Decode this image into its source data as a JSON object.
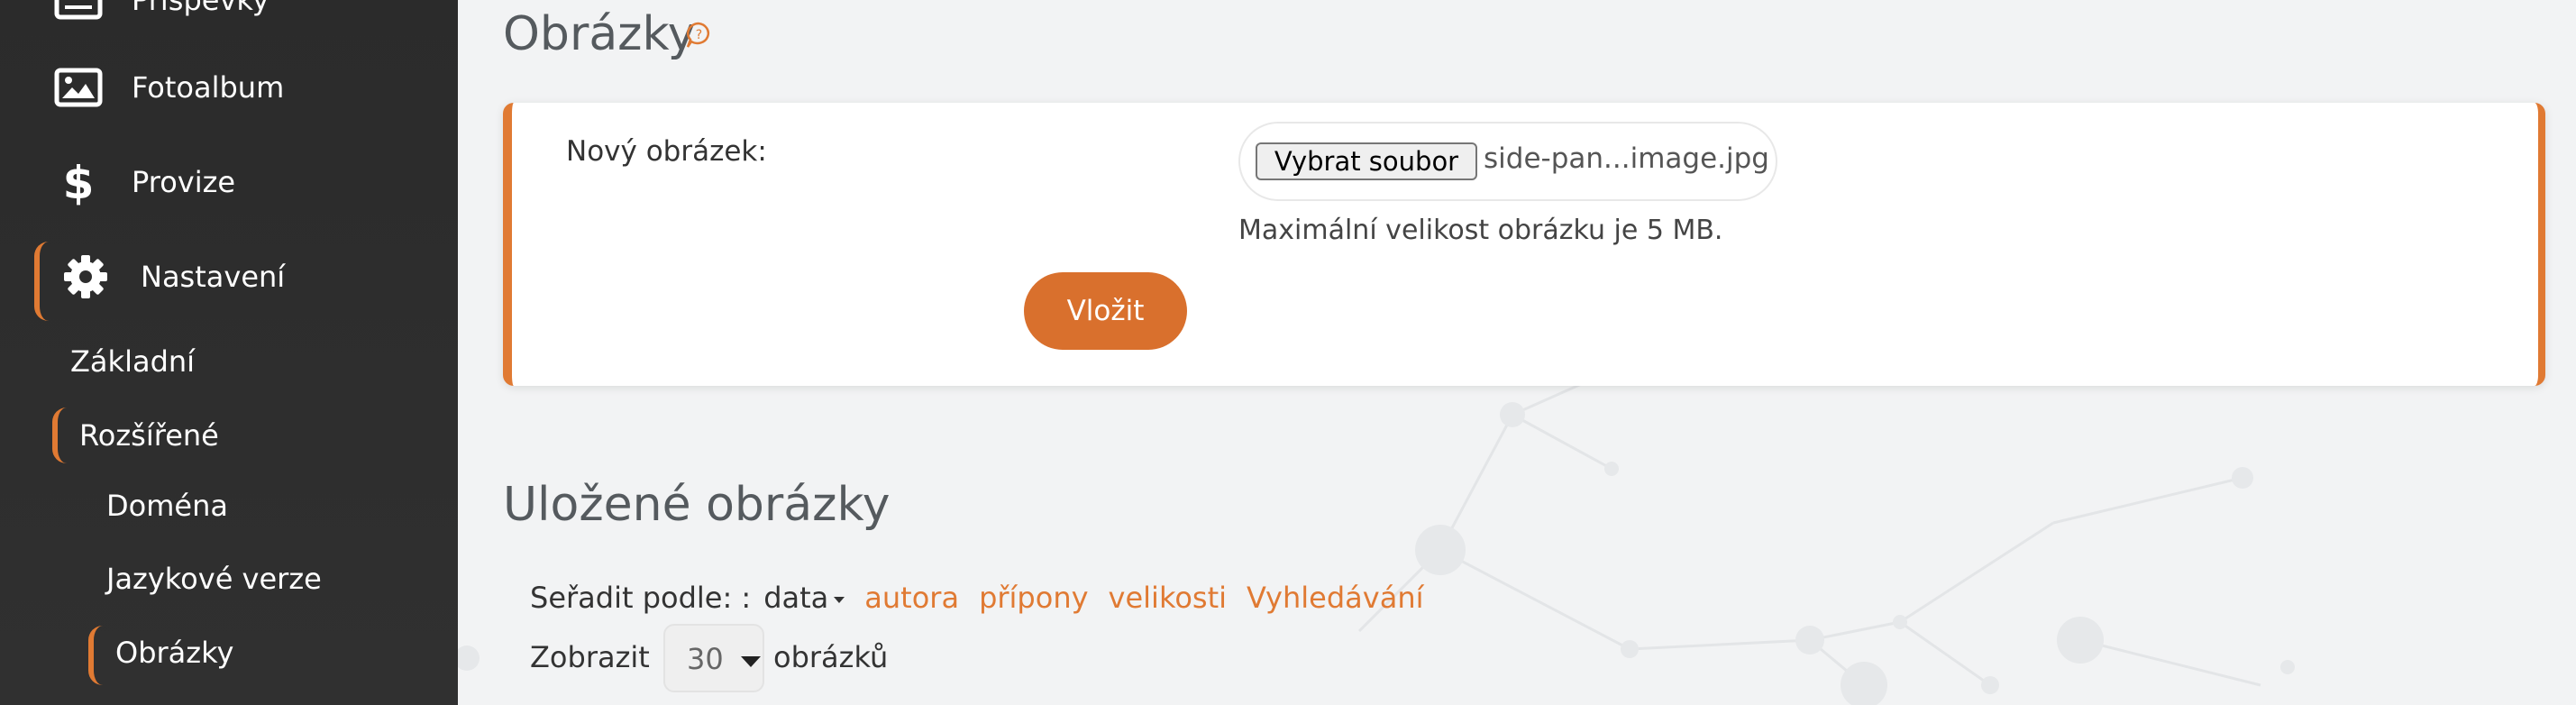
{
  "sidebar": {
    "items": [
      {
        "label": "Příspěvky",
        "icon": "newspaper-icon"
      },
      {
        "label": "Fotoalbum",
        "icon": "image-icon"
      },
      {
        "label": "Provize",
        "icon": "dollar-icon"
      },
      {
        "label": "Nastavení",
        "icon": "gear-icon",
        "active": true
      }
    ],
    "sub_items": [
      {
        "label": "Základní"
      },
      {
        "label": "Rozšířené",
        "active": true
      }
    ],
    "sub_sub_items": [
      {
        "label": "Doména"
      },
      {
        "label": "Jazykové verze"
      },
      {
        "label": "Obrázky",
        "active": true
      }
    ],
    "accent_color": "#e07a33"
  },
  "main": {
    "title": "Obrázky",
    "help_icon": "help-bubble-icon",
    "upload": {
      "label": "Nový obrázek:",
      "file_button": "Vybrat soubor",
      "file_name": "side-pan...image.jpg",
      "hint": "Maximální velikost obrázku je 5 MB.",
      "submit": "Vložit"
    },
    "saved": {
      "title": "Uložené obrázky",
      "sort_label": "Seřadit podle: :",
      "sort_active": "data",
      "sort_links": [
        "autora",
        "přípony",
        "velikosti",
        "Vyhledávání"
      ],
      "show_label": "Zobrazit",
      "show_value": "30",
      "show_suffix": "obrázků"
    },
    "accent_color": "#d9702d"
  }
}
